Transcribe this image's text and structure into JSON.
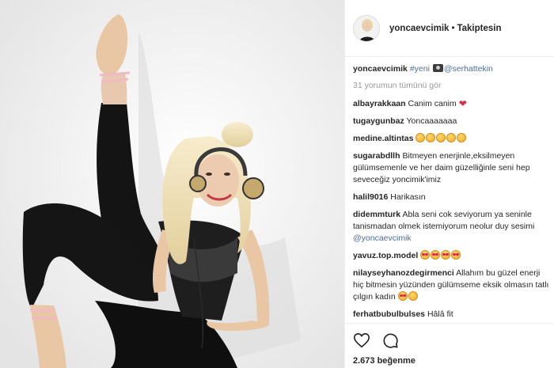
{
  "post": {
    "username": "yoncaevcimik",
    "separator": "•",
    "follow_state": "Takiptesin",
    "caption": {
      "user": "yoncaevcimik",
      "hashtag": "#yeni",
      "mention": "@serhattekin"
    },
    "view_all_comments": "31 yorumun tümünü gör",
    "likes": "2.673 beğenme"
  },
  "comments": [
    {
      "user": "albayrakkaan",
      "text": "Canim canim"
    },
    {
      "user": "tugaygunbaz",
      "text": "Yoncaaaaaaa"
    },
    {
      "user": "medine.altintas",
      "text": ""
    },
    {
      "user": "sugarabdllh",
      "text": "Bitmeyen enerjinle,eksilmeyen gülümsemenle ve her daim güzelliğinle seni hep seveceğiz yoncimik'imiz"
    },
    {
      "user": "halil9016",
      "text": "Harikasın"
    },
    {
      "user": "didemmturk",
      "text": "Abla seni cok seviyorum ya seninle tanismadan olmek istemiyorum neolur duy sesimi",
      "mention": "@yoncaevcimik"
    },
    {
      "user": "yavuz.top.model",
      "text": ""
    },
    {
      "user": "nilayseyhanozdegirmenci",
      "text": "Allahım bu güzel enerji hiç bitmesin yüzünden gülümseme eksik olmasın tatlı çılgın kadın"
    },
    {
      "user": "ferhatbubulbulses",
      "text": "Hâlâ fit"
    }
  ],
  "icons": {
    "like": "heart-outline-icon",
    "comment": "speech-bubble-icon",
    "caption_camera": "camera-emoji"
  },
  "colors": {
    "mention": "#4a6e9a",
    "heart_emoji": "#d6304a",
    "muted": "#999999"
  }
}
